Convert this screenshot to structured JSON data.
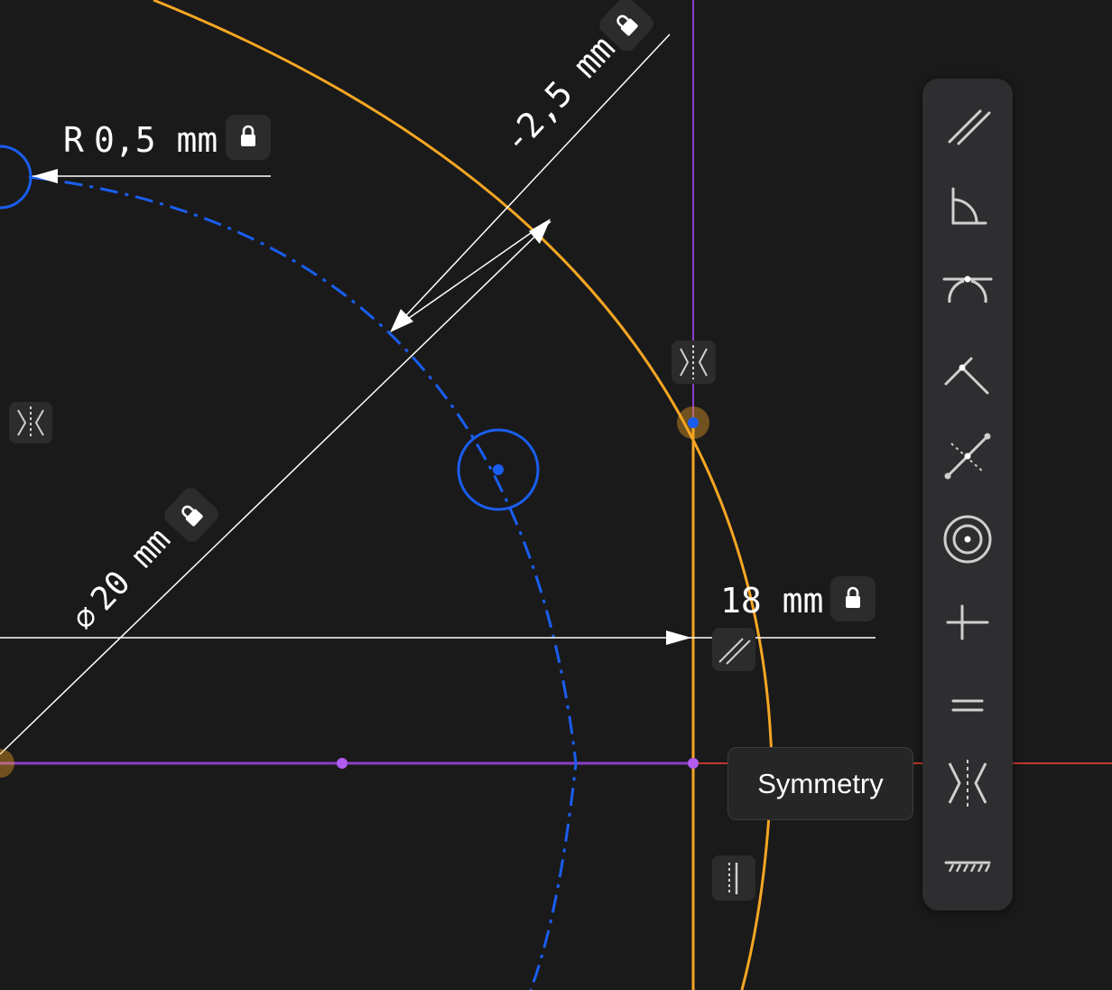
{
  "dimensions": {
    "radius": {
      "prefix": "R",
      "value": "0,5 mm"
    },
    "offset": {
      "value": "-2,5 mm"
    },
    "diameter": {
      "symbol": "⌀",
      "value": "20 mm"
    },
    "distance": {
      "value": "18 mm"
    }
  },
  "toolbar": {
    "tools": [
      {
        "name": "parallel",
        "icon": "parallel-icon"
      },
      {
        "name": "angle",
        "icon": "angle-icon"
      },
      {
        "name": "tangent",
        "icon": "tangent-icon"
      },
      {
        "name": "perpendicular",
        "icon": "perpendicular-icon"
      },
      {
        "name": "midpoint",
        "icon": "midpoint-icon"
      },
      {
        "name": "concentric",
        "icon": "concentric-icon"
      },
      {
        "name": "horizontal-vertical",
        "icon": "horizontal-vertical-icon"
      },
      {
        "name": "equal",
        "icon": "equal-icon"
      },
      {
        "name": "symmetry",
        "icon": "symmetry-icon"
      },
      {
        "name": "fix",
        "icon": "fix-icon"
      }
    ]
  },
  "tooltip": {
    "label": "Symmetry"
  },
  "colors": {
    "background": "#1a1a1a",
    "orange_geometry": "#f5a623",
    "blue_geometry": "#1a5ef0",
    "purple_axis": "#8b3fc8",
    "red_axis": "#c0392b",
    "dimension_lines": "#ffffff",
    "toolbar_bg": "#2e2e30"
  }
}
